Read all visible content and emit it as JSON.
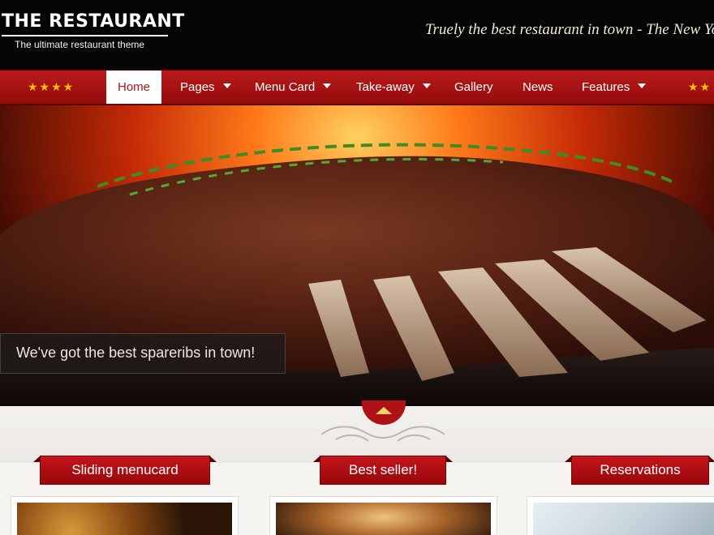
{
  "header": {
    "logo_title": "THE RESTAURANT",
    "logo_subtitle": "The ultimate restaurant theme",
    "tagline": "Truely the best restaurant in town - The New York T"
  },
  "nav": {
    "stars_left": "★★★★",
    "stars_right": "★★",
    "items": [
      {
        "label": "Home",
        "active": true,
        "has_dropdown": false
      },
      {
        "label": "Pages",
        "has_dropdown": true
      },
      {
        "label": "Menu Card",
        "has_dropdown": true
      },
      {
        "label": "Take-away",
        "has_dropdown": true
      },
      {
        "label": "Gallery",
        "has_dropdown": false
      },
      {
        "label": "News",
        "has_dropdown": false
      },
      {
        "label": "Features",
        "has_dropdown": true
      }
    ]
  },
  "hero": {
    "caption": "We've got the best spareribs in town!",
    "image": "grilled-spareribs-photo"
  },
  "sections": [
    {
      "title": "Sliding menucard",
      "image": "food-photo"
    },
    {
      "title": "Best seller!",
      "image": "restaurant-interior-photo"
    },
    {
      "title": "Reservations",
      "image": "calendar-photo"
    }
  ],
  "colors": {
    "nav_red": "#b3121a",
    "header_black": "#050505",
    "star_gold": "#f4c20d"
  }
}
